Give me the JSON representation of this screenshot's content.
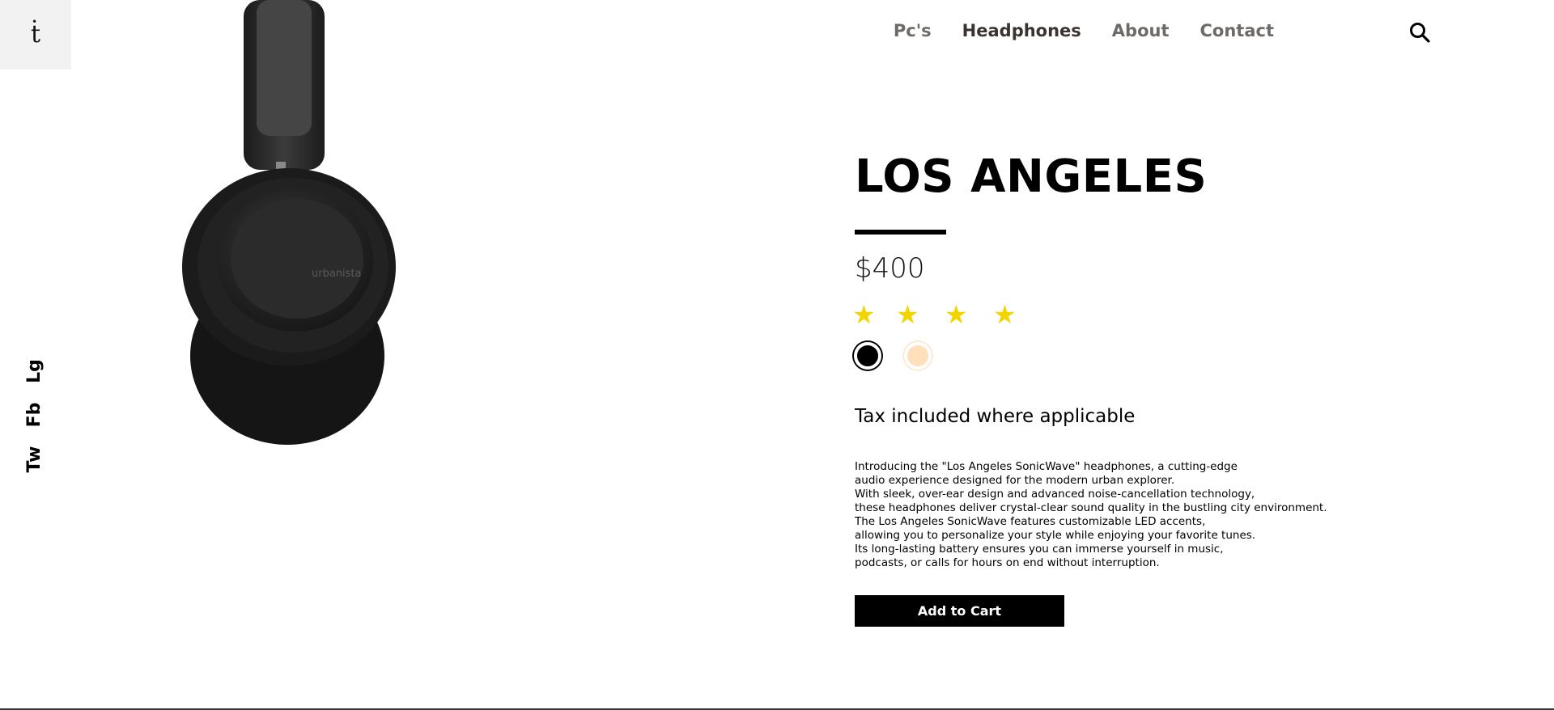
{
  "brand": {
    "logo_text": "ṫ"
  },
  "social": {
    "lg": "Lg",
    "fb": "Fb",
    "tw": "Tw"
  },
  "nav": {
    "items": [
      {
        "label": "Pc's",
        "active": false
      },
      {
        "label": "Headphones",
        "active": true
      },
      {
        "label": "About",
        "active": false
      },
      {
        "label": "Contact",
        "active": false
      }
    ],
    "search_icon": "search-icon"
  },
  "product": {
    "image_brand_text": "urbanista",
    "title": "LOS ANGELES",
    "price": "$400",
    "rating": 4,
    "rating_max": 4,
    "star_color": "#f2d500",
    "colors": [
      {
        "name": "black",
        "hex": "#000000",
        "selected": true
      },
      {
        "name": "cream",
        "hex": "#ffe0bb",
        "selected": false
      }
    ],
    "tax_note": "Tax included where applicable",
    "description_lines": [
      "Introducing the \"Los Angeles SonicWave\" headphones, a cutting-edge",
      "audio experience designed for the modern urban explorer.",
      "With sleek, over-ear design and advanced noise-cancellation technology,",
      "these headphones deliver crystal-clear sound quality in the bustling city environment.",
      "The Los Angeles SonicWave features customizable LED accents,",
      "allowing you to personalize your style while enjoying your favorite tunes.",
      "Its long-lasting battery ensures you can immerse yourself in music,",
      "podcasts, or calls for hours on end without interruption."
    ],
    "cta": "Add to Cart"
  }
}
